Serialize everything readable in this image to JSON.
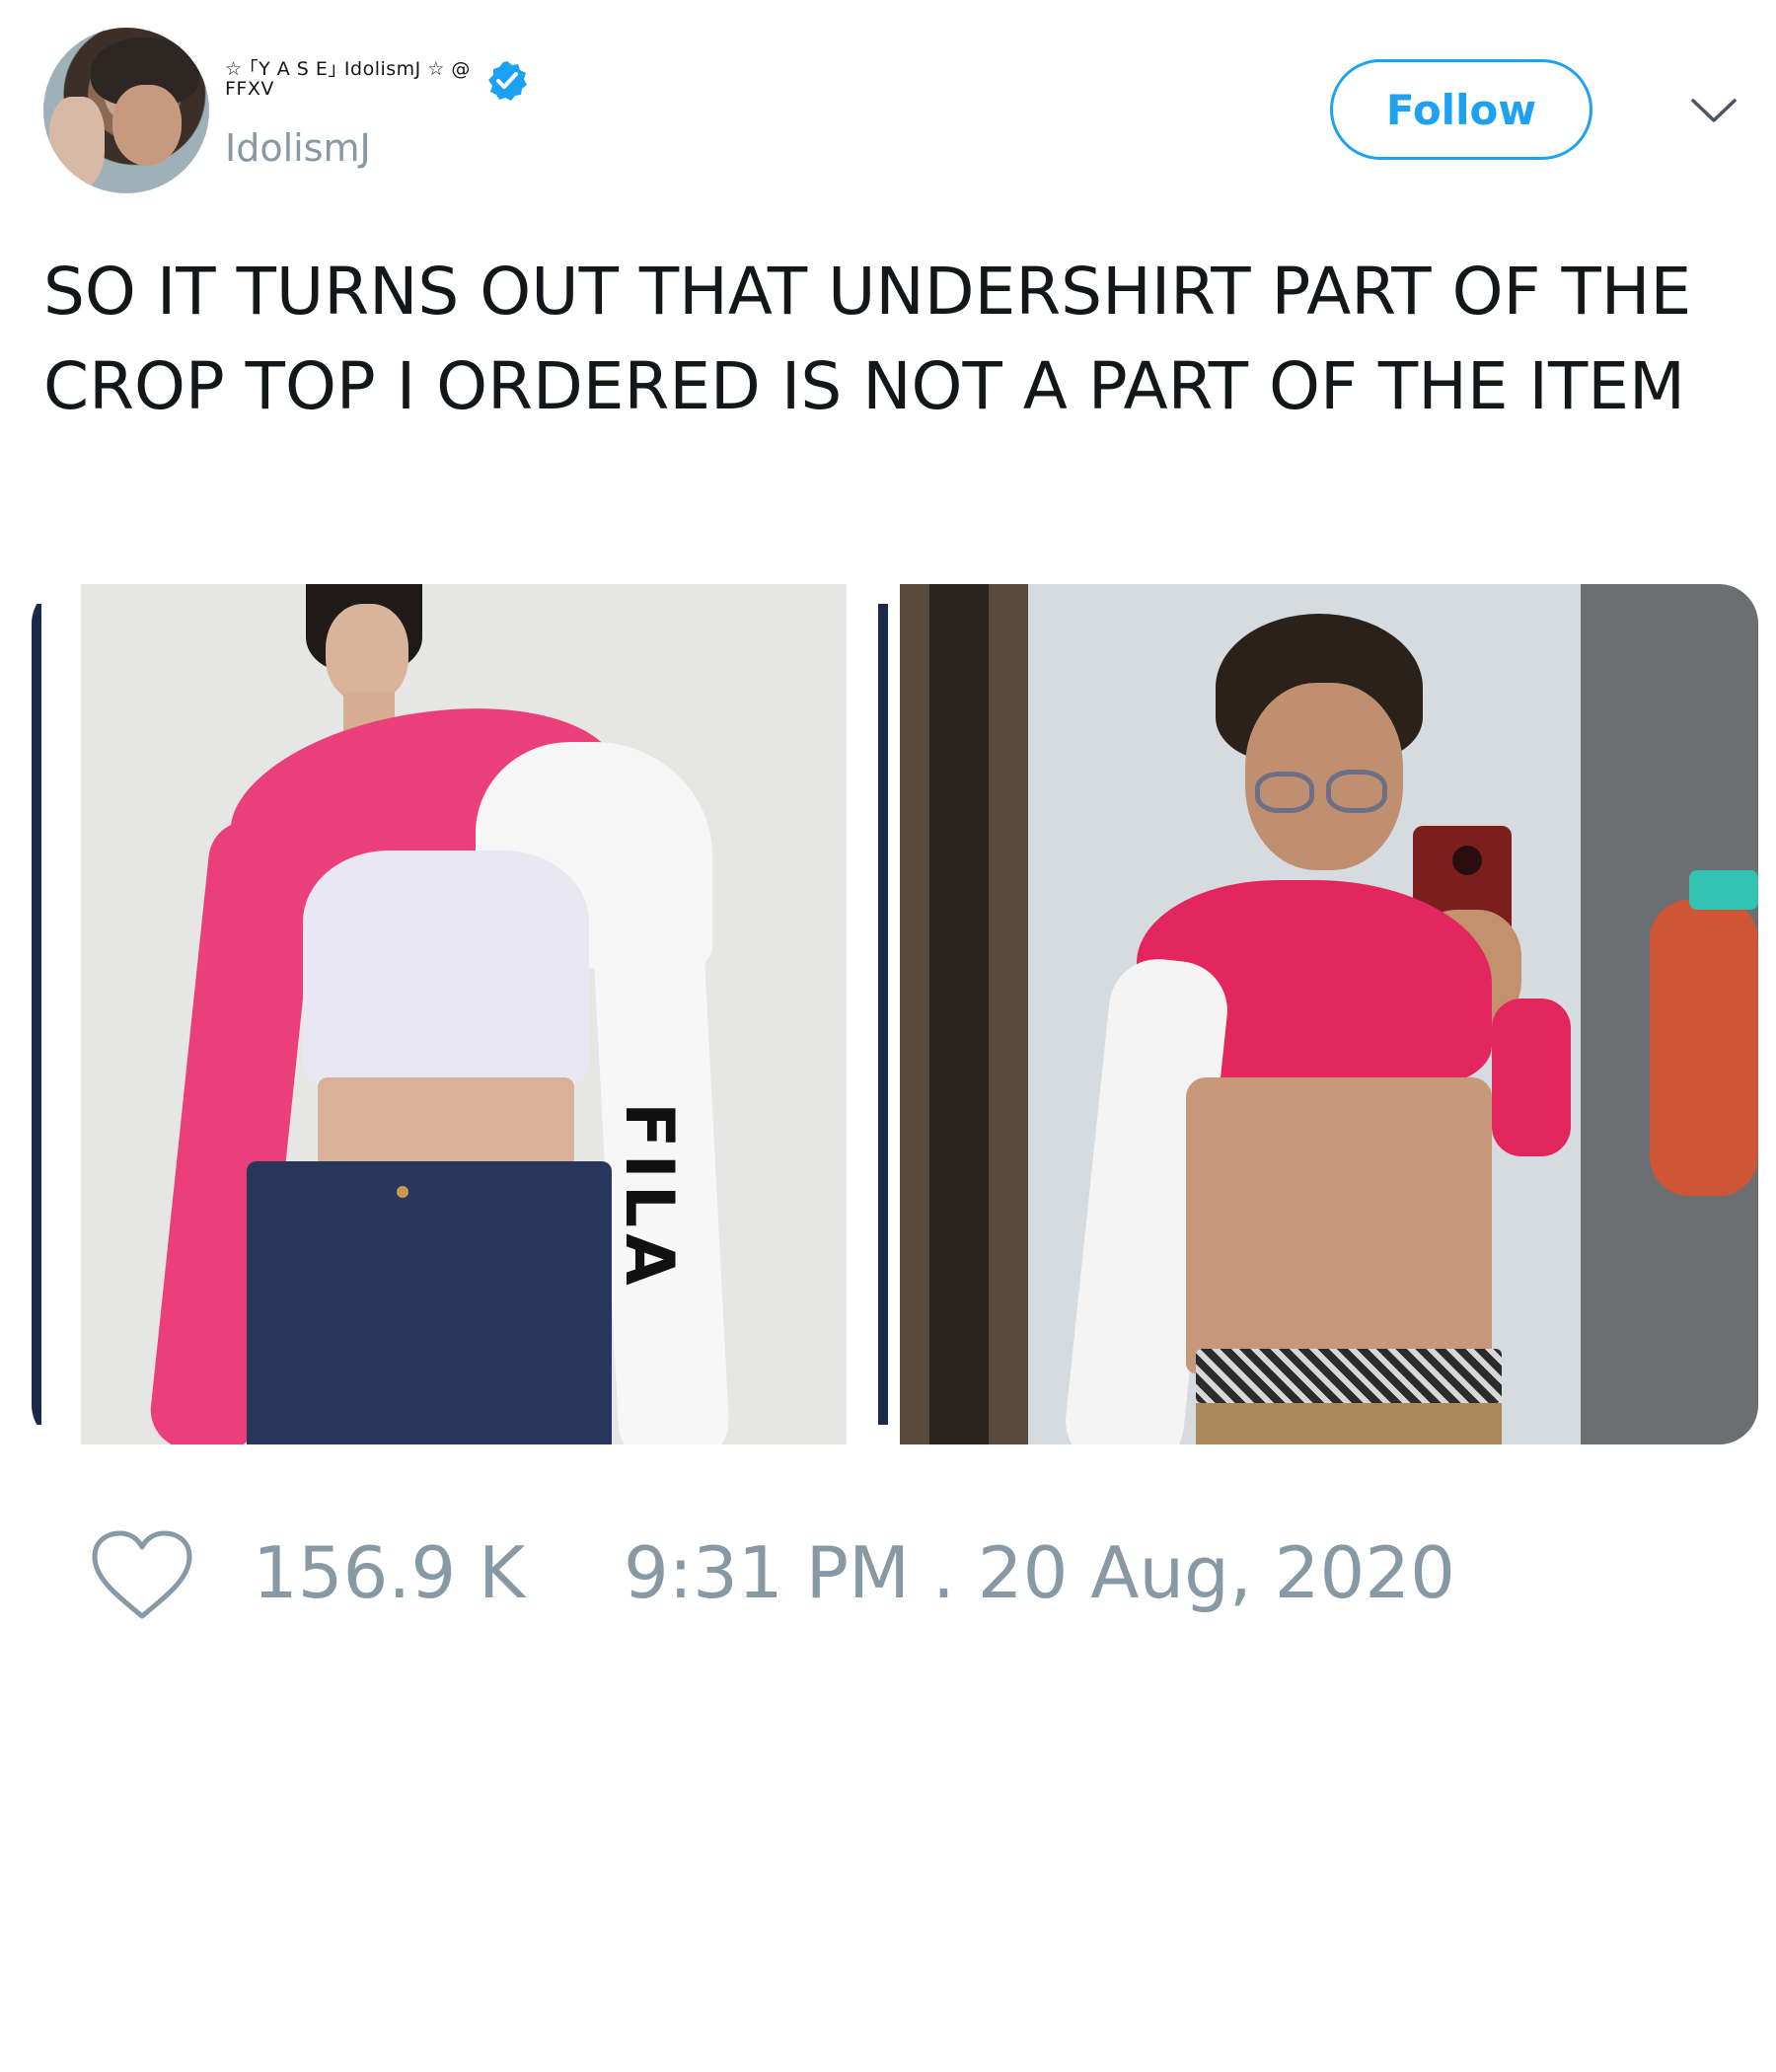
{
  "user": {
    "display_name": "☆ ｢Y A S E｣ IdolismJ ☆ @ FFXV",
    "handle": "IdolismJ",
    "verified": true
  },
  "follow": {
    "label": "Follow"
  },
  "menu": {
    "icon": "chevron-down-icon"
  },
  "tweet": {
    "text": "SO IT TURNS OUT THAT UNDERSHIRT PART OF THE CROP TOP I ORDERED IS NOT A PART OF THE ITEM"
  },
  "media": {
    "left_photo": "product-photo",
    "right_photo": "mirror-selfie",
    "left_sleeve_text": "FILA"
  },
  "actions": {
    "like_icon": "heart-icon",
    "like_count": "156.9 K",
    "timestamp": "9:31 PM . 20 Aug, 2020"
  },
  "colors": {
    "accent": "#1da1f2",
    "muted": "#8899a6",
    "text": "#14171a",
    "pink": "#e91e63"
  }
}
